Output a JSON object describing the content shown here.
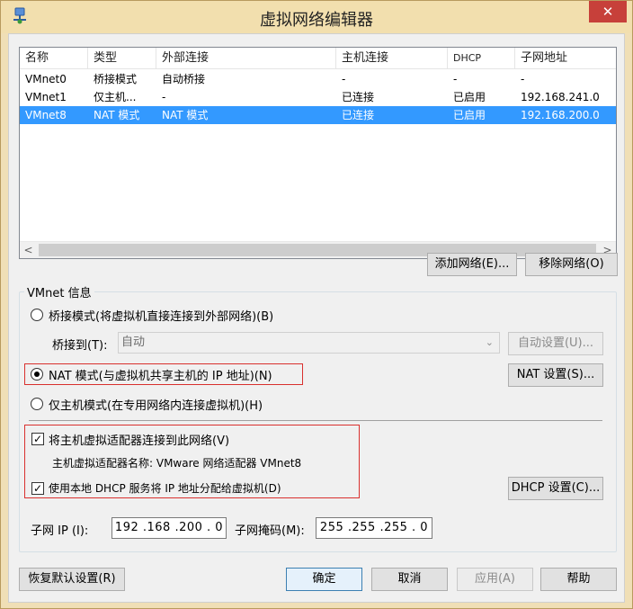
{
  "window": {
    "title": "虚拟网络编辑器",
    "close_label": "✕"
  },
  "list": {
    "columns": [
      "名称",
      "类型",
      "外部连接",
      "主机连接",
      "DHCP",
      "子网地址"
    ],
    "rows": [
      {
        "name": "VMnet0",
        "type": "桥接模式",
        "external": "自动桥接",
        "host": "-",
        "dhcp": "-",
        "subnet": "-"
      },
      {
        "name": "VMnet1",
        "type": "仅主机...",
        "external": "-",
        "host": "已连接",
        "dhcp": "已启用",
        "subnet": "192.168.241.0"
      },
      {
        "name": "VMnet8",
        "type": "NAT 模式",
        "external": "NAT 模式",
        "host": "已连接",
        "dhcp": "已启用",
        "subnet": "192.168.200.0"
      }
    ],
    "selected_row": "VMnet8",
    "scroll_left": "<",
    "scroll_right": ">"
  },
  "buttons": {
    "add_network": "添加网络(E)...",
    "remove_network": "移除网络(O)",
    "auto_settings": "自动设置(U)...",
    "nat_settings": "NAT 设置(S)...",
    "dhcp_settings": "DHCP 设置(C)...",
    "restore_defaults": "恢复默认设置(R)",
    "ok": "确定",
    "cancel": "取消",
    "apply": "应用(A)",
    "help": "帮助"
  },
  "vmnet_info": {
    "group_label": "VMnet 信息",
    "bridged_label": "桥接模式(将虚拟机直接连接到外部网络)(B)",
    "bridged_to_label": "桥接到(T):",
    "bridged_to_value": "自动",
    "nat_label": "NAT 模式(与虚拟机共享主机的 IP 地址)(N)",
    "hostonly_label": "仅主机模式(在专用网络内连接虚拟机)(H)",
    "selected_mode": "nat",
    "connect_adapter_label": "将主机虚拟适配器连接到此网络(V)",
    "connect_adapter_checked": true,
    "adapter_name_label": "主机虚拟适配器名称: VMware 网络适配器 VMnet8",
    "use_dhcp_label": "使用本地 DHCP 服务将 IP 地址分配给虚拟机(D)",
    "use_dhcp_checked": true,
    "subnet_ip_label": "子网 IP (I):",
    "subnet_ip_value": "192 .168 .200 .  0",
    "subnet_mask_label": "子网掩码(M):",
    "subnet_mask_value": "255 .255 .255 .  0"
  },
  "colors": {
    "selection": "#3399ff",
    "highlight_box": "#d9302e",
    "titlebar": "#f2dfae",
    "close": "#c7403a"
  }
}
